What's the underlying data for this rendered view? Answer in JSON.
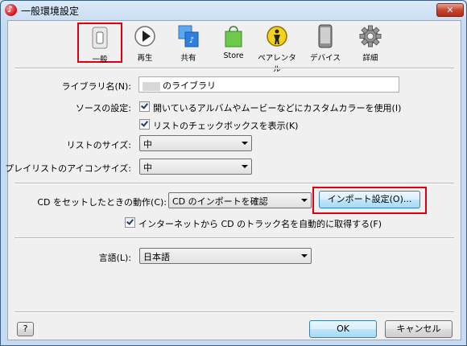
{
  "window": {
    "title": "一般環境設定",
    "close_label": "✕"
  },
  "toolbar": {
    "items": [
      {
        "label": "一般",
        "icon": "general-switch-icon"
      },
      {
        "label": "再生",
        "icon": "play-icon"
      },
      {
        "label": "共有",
        "icon": "sharing-music-icon"
      },
      {
        "label": "Store",
        "icon": "store-bag-icon"
      },
      {
        "label": "ペアレンタル",
        "icon": "parental-icon"
      },
      {
        "label": "デバイス",
        "icon": "device-icon"
      },
      {
        "label": "詳細",
        "icon": "gear-icon"
      }
    ],
    "selected": "一般"
  },
  "form": {
    "library_name_label": "ライブラリ名(N):",
    "library_name_value": "のライブラリ",
    "source_label": "ソースの設定:",
    "source_option1": "開いているアルバムやムービーなどにカスタムカラーを使用(I)",
    "source_option2": "リストのチェックボックスを表示(K)",
    "list_size_label": "リストのサイズ:",
    "list_size_value": "中",
    "playlist_icon_size_label": "プレイリストのアイコンサイズ:",
    "playlist_icon_size_value": "中",
    "cd_action_label": "CD をセットしたときの動作(C):",
    "cd_action_value": "CD のインポートを確認",
    "import_settings_button": "インポート設定(O)...",
    "cd_track_option": "インターネットから CD のトラック名を自動的に取得する(F)",
    "language_label": "言語(L):",
    "language_value": "日本語"
  },
  "footer": {
    "help_label": "?",
    "ok_label": "OK",
    "cancel_label": "キャンセル"
  },
  "colors": {
    "highlight": "#e00012",
    "accent": "#3c7fb1"
  }
}
